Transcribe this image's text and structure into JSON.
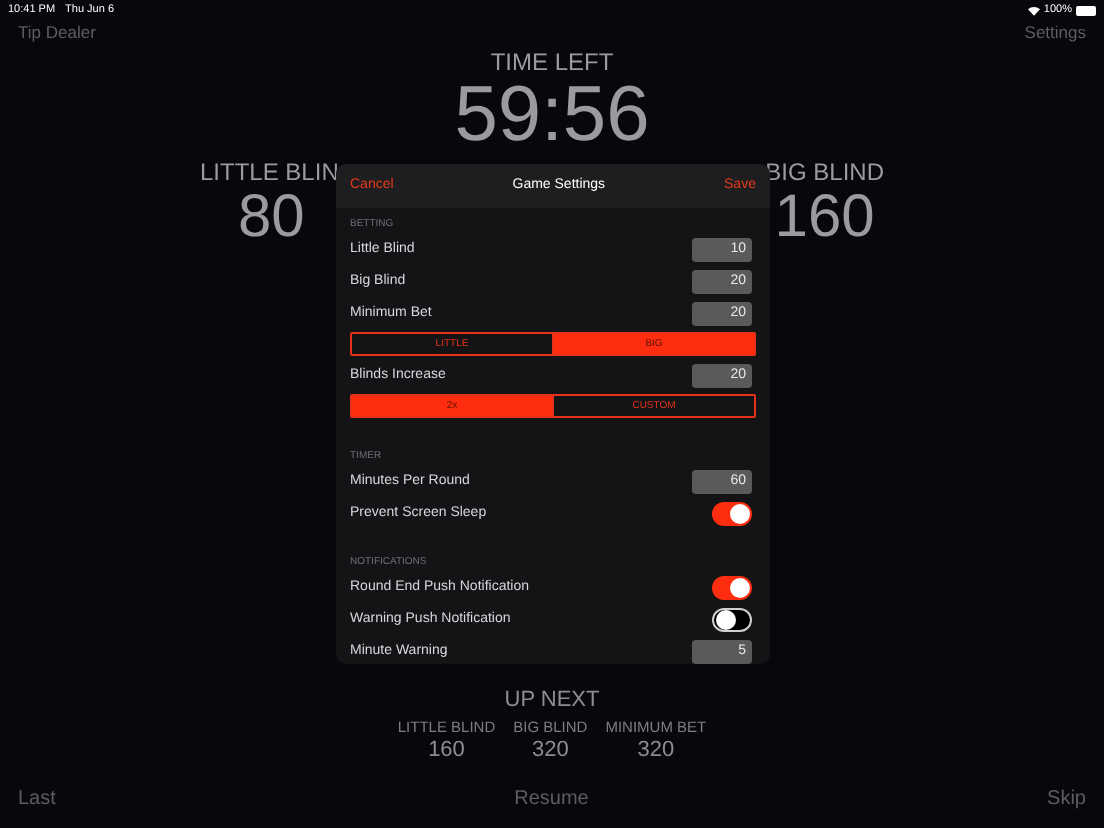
{
  "status_bar": {
    "time": "10:41 PM",
    "date": "Thu Jun 6",
    "battery": "100%"
  },
  "nav": {
    "left": "Tip Dealer",
    "right": "Settings"
  },
  "timer": {
    "label": "TIME LEFT",
    "value": "59:56"
  },
  "blinds": [
    {
      "label": "LITTLE BLIN",
      "value": "80"
    },
    {
      "label": "BIG BLIND",
      "value": "160"
    }
  ],
  "modal": {
    "cancel": "Cancel",
    "title": "Game Settings",
    "save": "Save",
    "sections": [
      {
        "header": "BETTING",
        "rows": [
          {
            "kind": "input",
            "label": "Little Blind",
            "value": "10"
          },
          {
            "kind": "input",
            "label": "Big Blind",
            "value": "20"
          },
          {
            "kind": "input",
            "label": "Minimum Bet",
            "value": "20"
          },
          {
            "kind": "segmented",
            "options": [
              {
                "label": "LITTLE",
                "selected": false
              },
              {
                "label": "BIG",
                "selected": true
              }
            ]
          },
          {
            "kind": "input",
            "label": "Blinds Increase",
            "value": "20"
          },
          {
            "kind": "segmented",
            "options": [
              {
                "label": "2x",
                "selected": true
              },
              {
                "label": "CUSTOM",
                "selected": false
              }
            ]
          }
        ]
      },
      {
        "header": "TIMER",
        "rows": [
          {
            "kind": "input",
            "label": "Minutes Per Round",
            "value": "60"
          },
          {
            "kind": "toggle",
            "label": "Prevent Screen Sleep",
            "on": true
          }
        ]
      },
      {
        "header": "NOTIFICATIONS",
        "rows": [
          {
            "kind": "toggle",
            "label": "Round End Push Notification",
            "on": true
          },
          {
            "kind": "toggle",
            "label": "Warning Push Notification",
            "on": false
          },
          {
            "kind": "input",
            "label": "Minute Warning",
            "value": "5"
          }
        ]
      }
    ]
  },
  "up_next": {
    "title": "UP NEXT",
    "items": [
      {
        "label": "LITTLE BLIND",
        "value": "160"
      },
      {
        "label": "BIG BLIND",
        "value": "320"
      },
      {
        "label": "MINIMUM BET",
        "value": "320"
      }
    ]
  },
  "bottom_bar": [
    {
      "label": "Last"
    },
    {
      "label": "Resume"
    },
    {
      "label": "Skip"
    }
  ]
}
